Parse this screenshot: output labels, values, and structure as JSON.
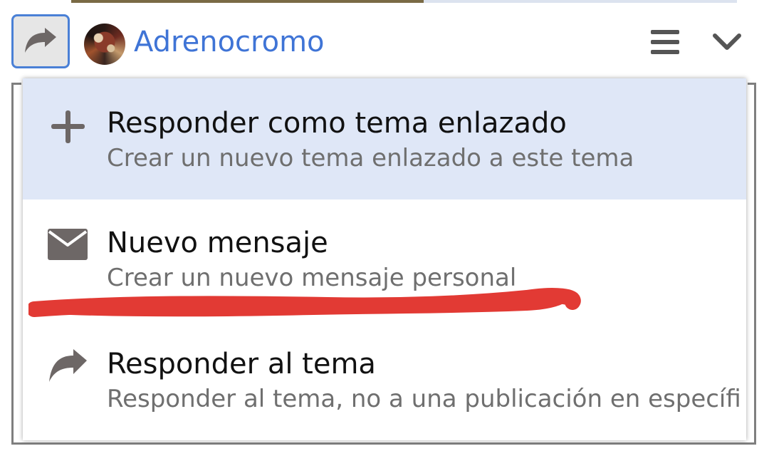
{
  "header": {
    "username": "Adrenocromo",
    "reply_icon": "share-arrow-icon",
    "menu_icon": "hamburger-menu-icon",
    "collapse_icon": "chevron-down-icon",
    "accent_color": "#3f74d6"
  },
  "dropdown": {
    "items": [
      {
        "icon": "plus-icon",
        "title": "Responder como tema enlazado",
        "description": "Crear un nuevo tema enlazado a este tema",
        "highlighted": true
      },
      {
        "icon": "envelope-icon",
        "title": "Nuevo mensaje",
        "description": "Crear un nuevo mensaje personal",
        "highlighted": false
      },
      {
        "icon": "reply-arrow-icon",
        "title": "Responder al tema",
        "description": "Responder al tema, no a una publicación en específi",
        "highlighted": false
      }
    ],
    "highlight_color": "#dfe7f7"
  },
  "annotation": {
    "scribble_color": "#e23a34"
  }
}
